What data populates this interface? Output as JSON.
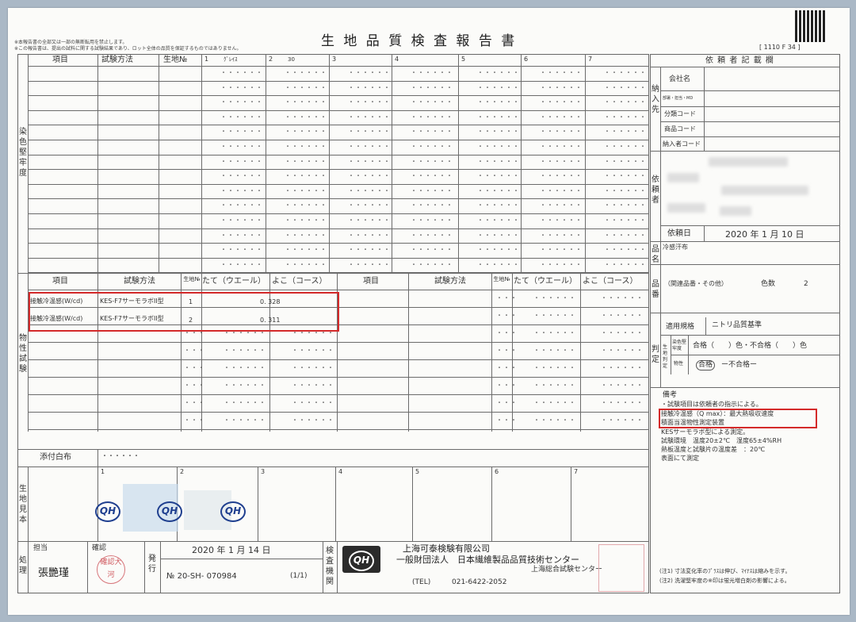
{
  "notes": [
    "※本報告書の全部又は一部の無断転用を禁止します。",
    "※この報告書は、提出の試料に関する試験結果であり、ロット全体の品質を保証するものではありません。"
  ],
  "title": "生 地 品 質 検 査 報 告 書",
  "form_code": "[ 1110 F 34 ]",
  "dye": {
    "section_label": "染色堅牢度",
    "headers": {
      "item": "項目",
      "method": "試験方法",
      "no": "生地№"
    },
    "cols": [
      "1",
      "2",
      "3",
      "4",
      "5",
      "6",
      "7"
    ],
    "col_names": [
      "ｸﾞﾚｲｽ",
      "30",
      "",
      "",
      "",
      "",
      ""
    ],
    "placeholder": "・・・・・・"
  },
  "phys": {
    "section_label": "物性試験",
    "headers": {
      "item": "項目",
      "method": "試験方法",
      "no": "生地№",
      "warp": "たて（ウエール）",
      "weft": "よこ（コース）"
    },
    "rows": [
      {
        "item": "接触冷温感(W/cd)",
        "method": "KES-F7サーモラボII型",
        "no": "1",
        "value": "0. 328"
      },
      {
        "item": "接触冷温感(W/cd)",
        "method": "KES-F7サーモラボII型",
        "no": "2",
        "value": "0. 311"
      }
    ],
    "placeholder": "・・・・・・",
    "small_dots": "・・・"
  },
  "attached": {
    "label": "添付白布",
    "value": "・・・・・・"
  },
  "sample": {
    "label": "生地見本",
    "cols": [
      "1",
      "2",
      "3",
      "4",
      "5",
      "6",
      "7"
    ]
  },
  "bottom": {
    "process_label": "処理",
    "charge_label": "担当",
    "charge_name": "張艷瑾",
    "confirm_label": "確認",
    "issue_label": "発行",
    "date": "2020 年  1 月 14 日",
    "report_no": "№ 20-SH- 070984",
    "page": "(1/1)",
    "org_label": "検査機関",
    "org1": "上海可泰検験有限公司",
    "org2": "一般財団法人　日本繊維製品品質技術センター",
    "org3": "上海総合試験センター",
    "tel_label": "(TEL)",
    "tel": "021-6422-2052"
  },
  "client": {
    "header": "依 頼 者 記 載 欄",
    "deliver_label": "納入先",
    "company": "会社名",
    "dept": "部署・担当・MD",
    "cat": "分類コード",
    "product_code": "商品コード",
    "vendor_code": "納入者コード",
    "requester_label": "依頼者",
    "req_date_label": "依頼日",
    "req_date": "2020 年  1 月 10 日",
    "product_label": "品名",
    "product_name": "冷感汗布",
    "part_label": "品番",
    "related": "（関連品番・その他）",
    "colors_label": "色数",
    "colors": "2",
    "standard_label": "適用規格",
    "standard": "ニトリ品質基準",
    "judge_label": "判定",
    "judge_sub": "生地判定",
    "j1_label": "染色堅牢度",
    "j1": "合格（　　）色・不合格（　　）色",
    "j2_label": "物性",
    "j2_pass": "合格",
    "j2_fail": "ー不合格ー",
    "remarks_title": "備考",
    "remarks": [
      "・試験項目は依頼者の指示による。",
      "接触冷温感（Q max）：最大熱吸収速度",
      "積面当温物性測定装置",
      "KESサーモラボ型による測定。",
      "試験環境　温度20±2℃　湿度65±4%RH",
      "熱板温度と試験片の温度差　：20℃",
      "表面にて測定"
    ],
    "foot1": "(注1) 寸法変化率のﾌﾟﾗｽは伸び、ﾏｲﾅｽは縮みを示す。",
    "foot2": "(注2) 洗濯堅牢度の※印は蛍光増白剤の影響による。"
  },
  "stamp1": "確認大河",
  "logo_text": "QH"
}
